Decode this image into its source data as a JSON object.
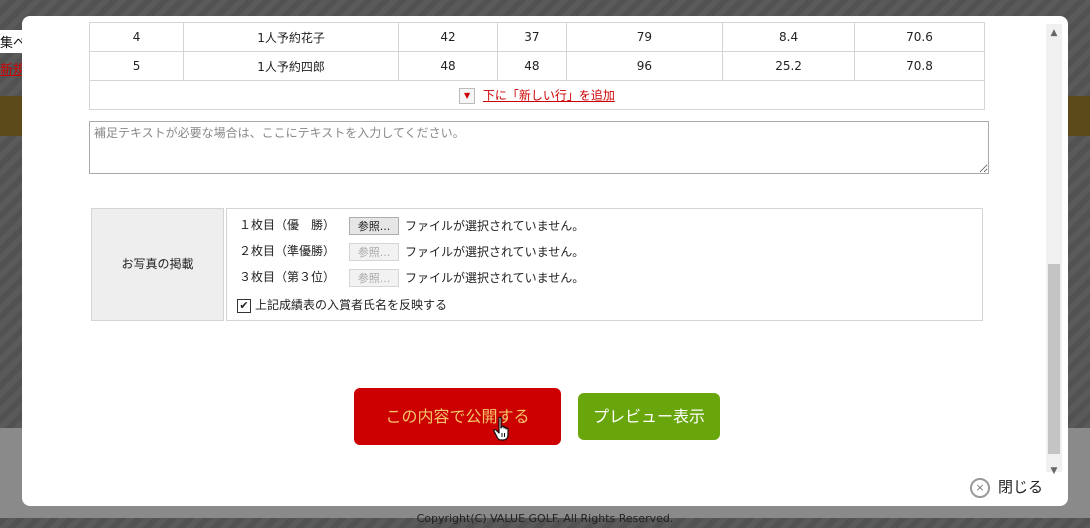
{
  "background": {
    "left_text_1": "集ペ",
    "left_text_2": "新規",
    "footer": "Copyright(C) VALUE GOLF. All Rights Reserved."
  },
  "scores_table": {
    "rows": [
      [
        "4",
        "1人予約花子",
        "42",
        "37",
        "79",
        "8.4",
        "70.6"
      ],
      [
        "5",
        "1人予約四郎",
        "48",
        "48",
        "96",
        "25.2",
        "70.8"
      ]
    ]
  },
  "add_row": {
    "dropdown_glyph": "▼",
    "link_label": "下に「新しい行」を追加"
  },
  "note": {
    "placeholder": "補足テキストが必要な場合は、ここにテキストを入力してください。"
  },
  "photos": {
    "label": "お写真の掲載",
    "files": [
      {
        "label": "１枚目（優　勝）",
        "button": "参照...",
        "status": "ファイルが選択されていません。",
        "enabled": true
      },
      {
        "label": "２枚目（準優勝）",
        "button": "参照...",
        "status": "ファイルが選択されていません。",
        "enabled": false
      },
      {
        "label": "３枚目（第３位）",
        "button": "参照...",
        "status": "ファイルが選択されていません。",
        "enabled": false
      }
    ],
    "checkbox_label": "上記成績表の入賞者氏名を反映する",
    "checkbox_checked": true,
    "check_glyph": "✔"
  },
  "buttons": {
    "publish": "この内容で公開する",
    "preview": "プレビュー表示"
  },
  "close": {
    "label": "閉じる",
    "icon_glyph": "×"
  },
  "colors": {
    "publish_bg": "#cc0000",
    "publish_text": "#f2c56a",
    "preview_bg": "#69a60c",
    "link_red": "#cc0000"
  }
}
